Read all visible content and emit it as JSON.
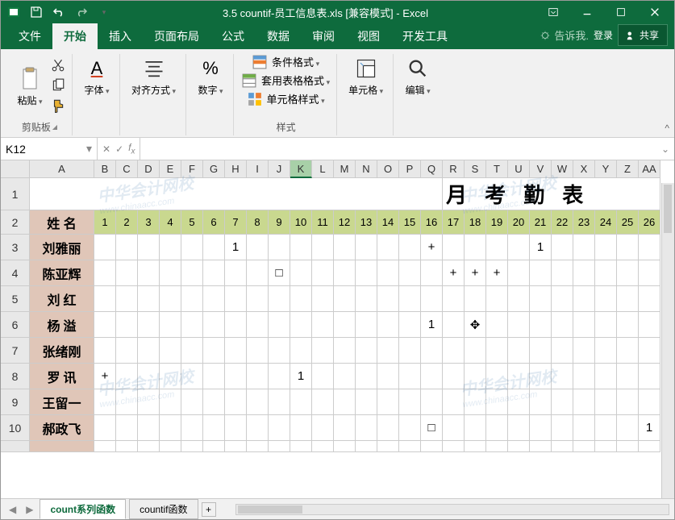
{
  "titlebar": {
    "title": "3.5 countif-员工信息表.xls [兼容模式] - Excel"
  },
  "tabs": {
    "file": "文件",
    "home": "开始",
    "insert": "插入",
    "layout": "页面布局",
    "formulas": "公式",
    "data": "数据",
    "review": "审阅",
    "view": "视图",
    "developer": "开发工具",
    "tellme": "告诉我.",
    "signin": "登录",
    "share": "共享"
  },
  "ribbon": {
    "clipboard": {
      "paste": "粘贴",
      "label": "剪贴板"
    },
    "font": {
      "label": "字体"
    },
    "align": {
      "label": "对齐方式"
    },
    "number": {
      "sym": "%",
      "label": "数字"
    },
    "styles": {
      "cond": "条件格式",
      "table": "套用表格格式",
      "cell": "单元格样式",
      "label": "样式"
    },
    "cells": {
      "label": "单元格"
    },
    "editing": {
      "label": "编辑"
    }
  },
  "namebox": {
    "ref": "K12"
  },
  "cols": [
    "A",
    "B",
    "C",
    "D",
    "E",
    "F",
    "G",
    "H",
    "I",
    "J",
    "K",
    "L",
    "M",
    "N",
    "O",
    "P",
    "Q",
    "R",
    "S",
    "T",
    "U",
    "V",
    "W",
    "X",
    "Y",
    "Z",
    "AA"
  ],
  "title_row": "月 考 勤 表",
  "header_row": {
    "name": "姓 名",
    "days": [
      "1",
      "2",
      "3",
      "4",
      "5",
      "6",
      "7",
      "8",
      "9",
      "10",
      "11",
      "12",
      "13",
      "14",
      "15",
      "16",
      "17",
      "18",
      "19",
      "20",
      "21",
      "22",
      "23",
      "24",
      "25",
      "26"
    ]
  },
  "rows": [
    {
      "n": "3",
      "name": "刘雅丽",
      "cells": {
        "7": "1",
        "16": "+",
        "21": "1"
      }
    },
    {
      "n": "4",
      "name": "陈亚辉",
      "cells": {
        "9": "□",
        "17": "+",
        "18": "+",
        "19": "+"
      }
    },
    {
      "n": "5",
      "name": "刘  红",
      "cells": {}
    },
    {
      "n": "6",
      "name": "杨  溢",
      "cells": {
        "16": "1",
        "18": "✥"
      }
    },
    {
      "n": "7",
      "name": "张绪刚",
      "cells": {}
    },
    {
      "n": "8",
      "name": "罗  讯",
      "cells": {
        "1": "+",
        "10": "1"
      }
    },
    {
      "n": "9",
      "name": "王留一",
      "cells": {}
    },
    {
      "n": "10",
      "name": "郝政飞",
      "cells": {
        "16": "□",
        "26": "1"
      }
    }
  ],
  "sheets": {
    "s1": "count系列函数",
    "s2": "countif函数"
  },
  "watermark": {
    "big": "中华会计网校",
    "small": "www.chinaacc.com"
  }
}
